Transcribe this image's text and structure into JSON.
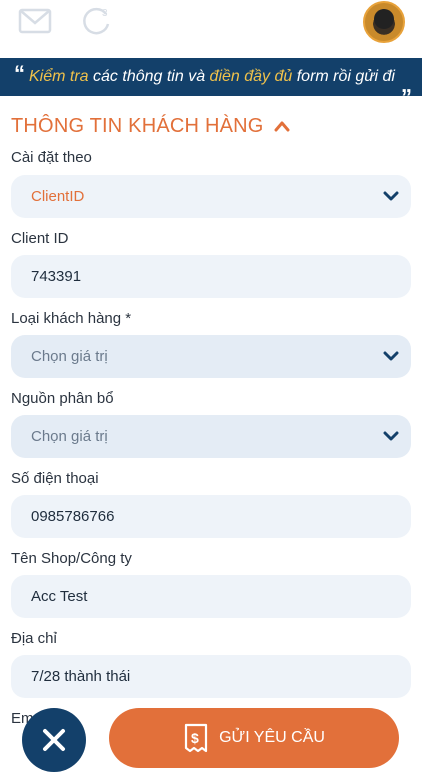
{
  "header": {
    "icons": [
      "mail-icon",
      "refresh-icon"
    ],
    "avatar": "user-avatar"
  },
  "banner": {
    "quote_open": "“",
    "part1": "Kiểm tra",
    "part2": " các thông tin và ",
    "part3": "điền đầy đủ",
    "part4": " form rồi gửi đi",
    "quote_close": "„"
  },
  "section": {
    "title": "THÔNG TIN KHÁCH HÀNG"
  },
  "form": {
    "setting": {
      "label": "Cài đặt theo",
      "value": "ClientID"
    },
    "client_id": {
      "label": "Client ID",
      "value": "743391"
    },
    "customer_type": {
      "label": "Loại khách hàng *",
      "value": "Chọn giá trị"
    },
    "source": {
      "label": "Nguồn phân bổ",
      "value": "Chọn giá trị"
    },
    "phone": {
      "label": "Số điện thoại",
      "value": "0985786766"
    },
    "shop": {
      "label": "Tên Shop/Công ty",
      "value": "Acc Test"
    },
    "address": {
      "label": "Địa chỉ",
      "value": "7/28 thành thái"
    },
    "email_partial": {
      "label": "Em"
    }
  },
  "actions": {
    "submit_label": "GỬI YÊU CẦU"
  },
  "colors": {
    "accent": "#e2703a",
    "navy": "#13406a",
    "highlight": "#f0c24b",
    "field_bg": "#eef3f9"
  }
}
